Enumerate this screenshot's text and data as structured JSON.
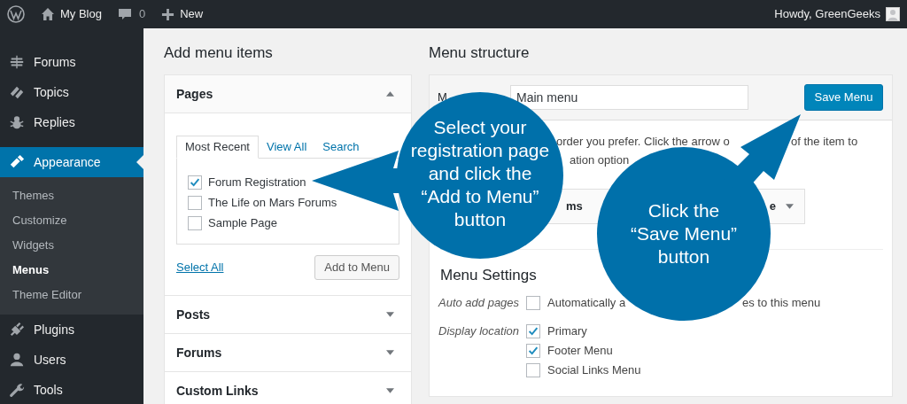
{
  "admin_bar": {
    "site": "My Blog",
    "comments": "0",
    "new": "New",
    "greeting": "Howdy, GreenGeeks"
  },
  "sidebar": {
    "items": [
      {
        "label": "Forums",
        "selected": false
      },
      {
        "label": "Topics",
        "selected": false
      },
      {
        "label": "Replies",
        "selected": false
      },
      {
        "label": "Appearance",
        "selected": true,
        "children": [
          {
            "label": "Themes",
            "selected": false
          },
          {
            "label": "Customize",
            "selected": false
          },
          {
            "label": "Widgets",
            "selected": false
          },
          {
            "label": "Menus",
            "selected": true
          },
          {
            "label": "Theme Editor",
            "selected": false
          }
        ]
      },
      {
        "label": "Plugins",
        "selected": false
      },
      {
        "label": "Users",
        "selected": false
      },
      {
        "label": "Tools",
        "selected": false
      }
    ]
  },
  "add_menu_items": {
    "title": "Add menu items",
    "sections": [
      {
        "title": "Pages",
        "expanded": true,
        "tabs": [
          {
            "label": "Most Recent",
            "selected": true
          },
          {
            "label": "View All",
            "selected": false
          },
          {
            "label": "Search",
            "selected": false
          }
        ],
        "items": [
          {
            "label": "Forum Registration",
            "checked": true
          },
          {
            "label": "The Life on Mars Forums",
            "checked": false
          },
          {
            "label": "Sample Page",
            "checked": false
          }
        ],
        "select_all": "Select All",
        "add_button": "Add to Menu"
      },
      {
        "title": "Posts",
        "expanded": false
      },
      {
        "title": "Forums",
        "expanded": false
      },
      {
        "title": "Custom Links",
        "expanded": false
      }
    ]
  },
  "menu_structure": {
    "title": "Menu structure",
    "name_label": "M",
    "menu_name": "Main menu",
    "save_button": "Save Menu",
    "instruction_lines": [
      [
        "order you prefer. Click the arrow o",
        "of the item to"
      ],
      [
        "ation option"
      ]
    ],
    "menu_item": [
      "ms",
      "e"
    ],
    "settings": {
      "title": "Menu Settings",
      "groups": [
        {
          "label": "Auto add pages",
          "options": [
            {
              "parts": [
                "Automatically a",
                "es to this menu"
              ],
              "checked": false
            }
          ]
        },
        {
          "label": "Display location",
          "options": [
            {
              "parts": [
                "Primary"
              ],
              "checked": true
            },
            {
              "parts": [
                "Footer Menu"
              ],
              "checked": true
            },
            {
              "parts": [
                "Social Links Menu"
              ],
              "checked": false
            }
          ]
        }
      ]
    }
  },
  "callouts": [
    {
      "text": "Select your\nregistration page\nand click the\n“Add to Menu”\nbutton"
    },
    {
      "text": "Click the\n“Save Menu”\nbutton"
    }
  ]
}
